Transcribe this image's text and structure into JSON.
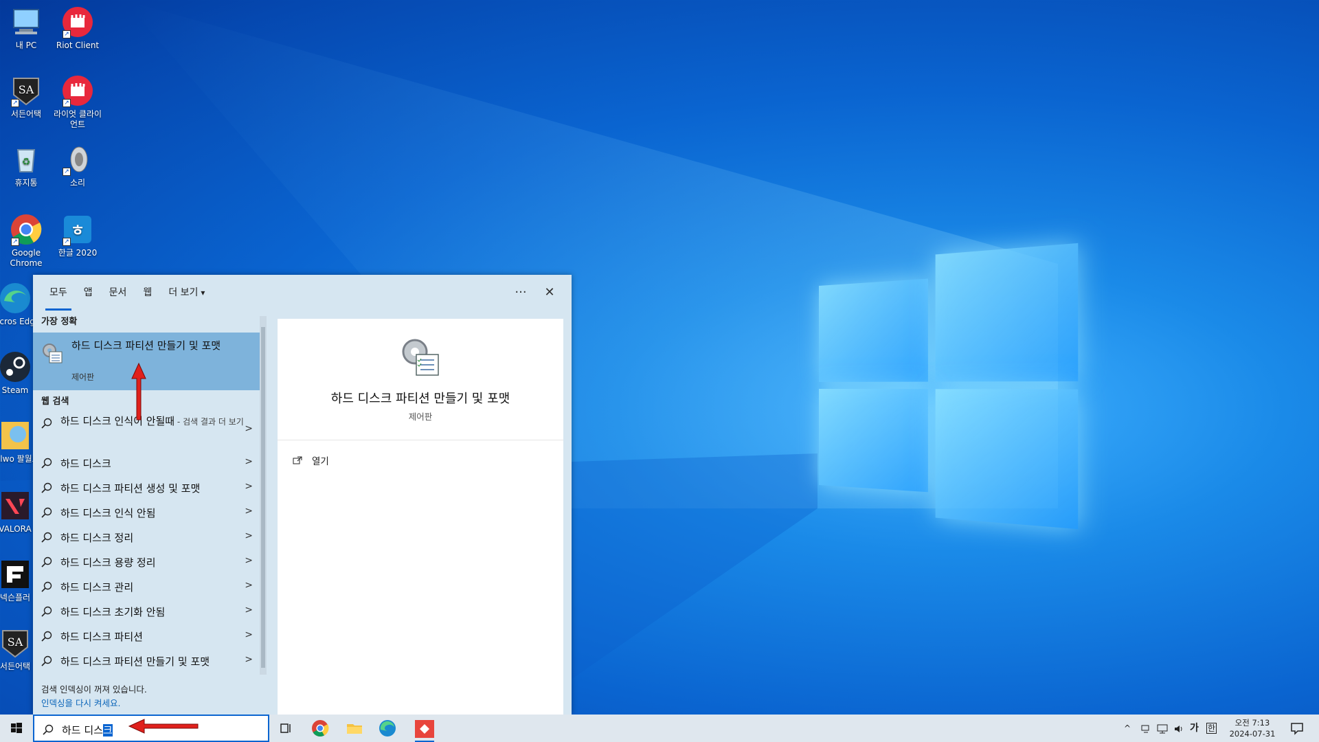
{
  "desktop": {
    "icons": [
      {
        "label": "내 PC"
      },
      {
        "label": "Riot Client"
      },
      {
        "label": "서든어택"
      },
      {
        "label": "라이엇 클라이언트"
      },
      {
        "label": "휴지통"
      },
      {
        "label": "소리"
      },
      {
        "label": "Google Chrome"
      },
      {
        "label": "한글 2020"
      },
      {
        "label": "Micros Edge"
      },
      {
        "label": "Steam"
      },
      {
        "label": "Palwo 팔월드"
      },
      {
        "label": "VALORA"
      },
      {
        "label": "넥슨플러"
      },
      {
        "label": "서든어택"
      }
    ]
  },
  "search_panel": {
    "tabs": [
      {
        "label": "모두"
      },
      {
        "label": "앱"
      },
      {
        "label": "문서"
      },
      {
        "label": "웹"
      },
      {
        "label": "더 보기"
      }
    ],
    "more_button": "···",
    "close_button": "✕",
    "best_match_header": "가장 정확",
    "best_match": {
      "title": "하드 디스크 파티션 만들기 및 포맷",
      "subtitle": "제어판"
    },
    "web_search_header": "웹 검색",
    "web_results": [
      {
        "label": "하드 디스크 인식이 안될때",
        "suffix": " - 검색 결과 더 보기"
      },
      {
        "label": "하드 디스크",
        "suffix": ""
      },
      {
        "label": "하드 디스크 파티션 생성 및 포맷",
        "suffix": ""
      },
      {
        "label": "하드 디스크 인식 안됨",
        "suffix": ""
      },
      {
        "label": "하드 디스크 정리",
        "suffix": ""
      },
      {
        "label": "하드 디스크 용량 정리",
        "suffix": ""
      },
      {
        "label": "하드 디스크 관리",
        "suffix": ""
      },
      {
        "label": "하드 디스크 초기화 안됨",
        "suffix": ""
      },
      {
        "label": "하드 디스크 파티션",
        "suffix": ""
      },
      {
        "label": "하드 디스크 파티션 만들기 및 포맷",
        "suffix": ""
      }
    ],
    "footer_text": "검색 인덱싱이 꺼져 있습니다.",
    "footer_link": "인덱싱을 다시 켜세요.",
    "preview": {
      "title": "하드 디스크 파티션 만들기 및 포맷",
      "subtitle": "제어판",
      "action_open": "열기"
    }
  },
  "taskbar": {
    "search_text": "하드 디스",
    "search_text_selected": "크",
    "tray_ime": "가",
    "tray_lang": "한",
    "clock_period": "오전 7:13",
    "clock_date": "2024-07-31"
  },
  "colors": {
    "accent": "#0a64d0",
    "selected_result": "#7eb3db",
    "panel_bg": "#d6e6f1",
    "annotation_arrow": "#e0201c"
  }
}
